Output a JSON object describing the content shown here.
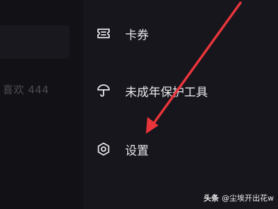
{
  "background_page": {
    "likes_text": "喜欢 444"
  },
  "drawer": {
    "items": [
      {
        "label": "卡券",
        "icon": "ticket-icon"
      },
      {
        "label": "未成年保护工具",
        "icon": "umbrella-icon"
      },
      {
        "label": "设置",
        "icon": "gear-icon"
      }
    ]
  },
  "annotation": {
    "arrow_color": "#e8353b"
  },
  "watermark": {
    "brand": "头条",
    "author": "@尘埃开出花w"
  }
}
